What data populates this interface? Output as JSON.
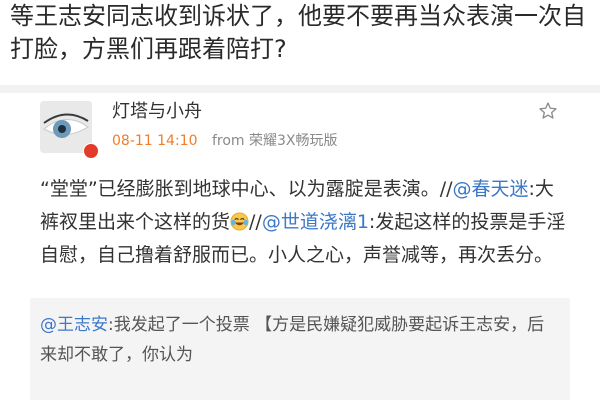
{
  "top_text": "等王志安同志收到诉状了，他要不要再当众表演一次自打脸，方黑们再跟着陪打?",
  "post": {
    "user_name": "灯塔与小舟",
    "time": "08-11 14:10",
    "from_label": "from",
    "device": "荣耀3X畅玩版",
    "body_1": "“堂堂”已经膨胀到地球中心、以为露腚是表演。//",
    "mention_1": "@春天迷",
    "body_2": ":大裤衩里出来个这样的货",
    "body_3": "//",
    "mention_2": "@世道浇漓1",
    "body_4": ":发起这样的投票是手淫自慰，自己撸着舒服而已。小人之心，声誉减等，再次丢分。",
    "emoji": "crying-laughing-emoji",
    "star": "star-icon"
  },
  "quote": {
    "mention": "@王志安",
    "text": ":我发起了一个投票 【方是民嫌疑犯威胁要起诉王志安，后来却不敢了，你认为"
  },
  "colors": {
    "link": "#3c78c8",
    "time": "#ef7d2b",
    "badge": "#e23b2a"
  }
}
